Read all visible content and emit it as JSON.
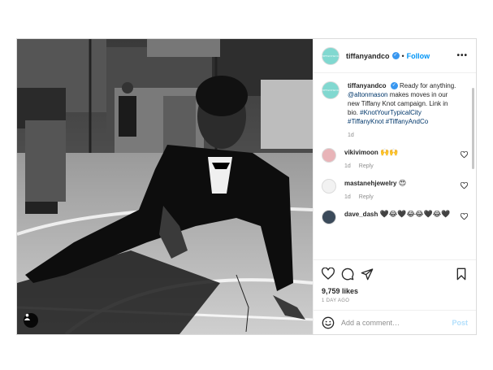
{
  "account": {
    "username": "tiffanyandco",
    "avatar_text": "TIFFANY&CO.",
    "verified_mark": "✓",
    "separator": "•",
    "follow_label": "Follow",
    "more_label": "•••"
  },
  "caption": {
    "username": "tiffanyandco",
    "text_before": "Ready for anything.",
    "mention": "@altonmason",
    "text_after": "makes moves in our new Tiffany Knot campaign. Link in bio.",
    "hashtags": [
      "#KnotYourTypicalCity",
      "#TiffanyKnot",
      "#TiffanyAndCo"
    ],
    "age": "1d"
  },
  "comments": [
    {
      "username": "vikivimoon",
      "text": "🙌🙌",
      "age": "1d",
      "reply_label": "Reply",
      "avatar_color": "#e8b4b8"
    },
    {
      "username": "mastanehjewelry",
      "text": "😍",
      "age": "1d",
      "reply_label": "Reply",
      "avatar_color": "#f2f2f2"
    },
    {
      "username": "dave_dash",
      "text": "🖤😂🖤😂😂🖤😂🖤",
      "age": "",
      "reply_label": "",
      "avatar_color": "#3b4a5a"
    }
  ],
  "actions": {
    "like": "heart-icon",
    "comment": "comment-icon",
    "share": "share-icon",
    "save": "bookmark-icon"
  },
  "likes_text": "9,759 likes",
  "time_ago": "1 DAY AGO",
  "add_comment": {
    "placeholder": "Add a comment…",
    "post_label": "Post"
  },
  "colors": {
    "link": "#00376b",
    "follow": "#0095f6",
    "brand": "#81d8d0",
    "post_disabled": "#b2dffc"
  }
}
